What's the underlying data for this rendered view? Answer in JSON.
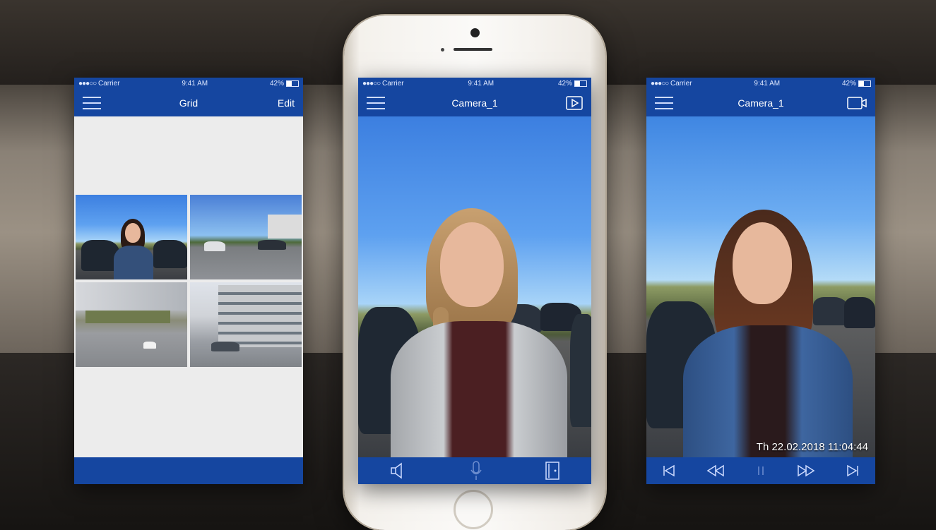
{
  "status": {
    "carrier": "Carrier",
    "time": "9:41 AM",
    "battery": "42%",
    "signal": "●●●○○"
  },
  "left_screen": {
    "title": "Grid",
    "edit_label": "Edit"
  },
  "center_screen": {
    "title": "Camera_1"
  },
  "right_screen": {
    "title": "Camera_1",
    "timestamp": "Th 22.02.2018 11:04:44"
  },
  "colors": {
    "bar": "#1546a0",
    "screen_bg": "#ececec"
  },
  "icons": {
    "center_bottom": [
      "speaker-icon",
      "microphone-icon",
      "door-icon"
    ],
    "right_bottom": [
      "skip-back-icon",
      "rewind-icon",
      "pause-icon",
      "fast-forward-icon",
      "skip-forward-icon"
    ],
    "center_nav": "play-icon",
    "right_nav": "video-camera-icon"
  }
}
